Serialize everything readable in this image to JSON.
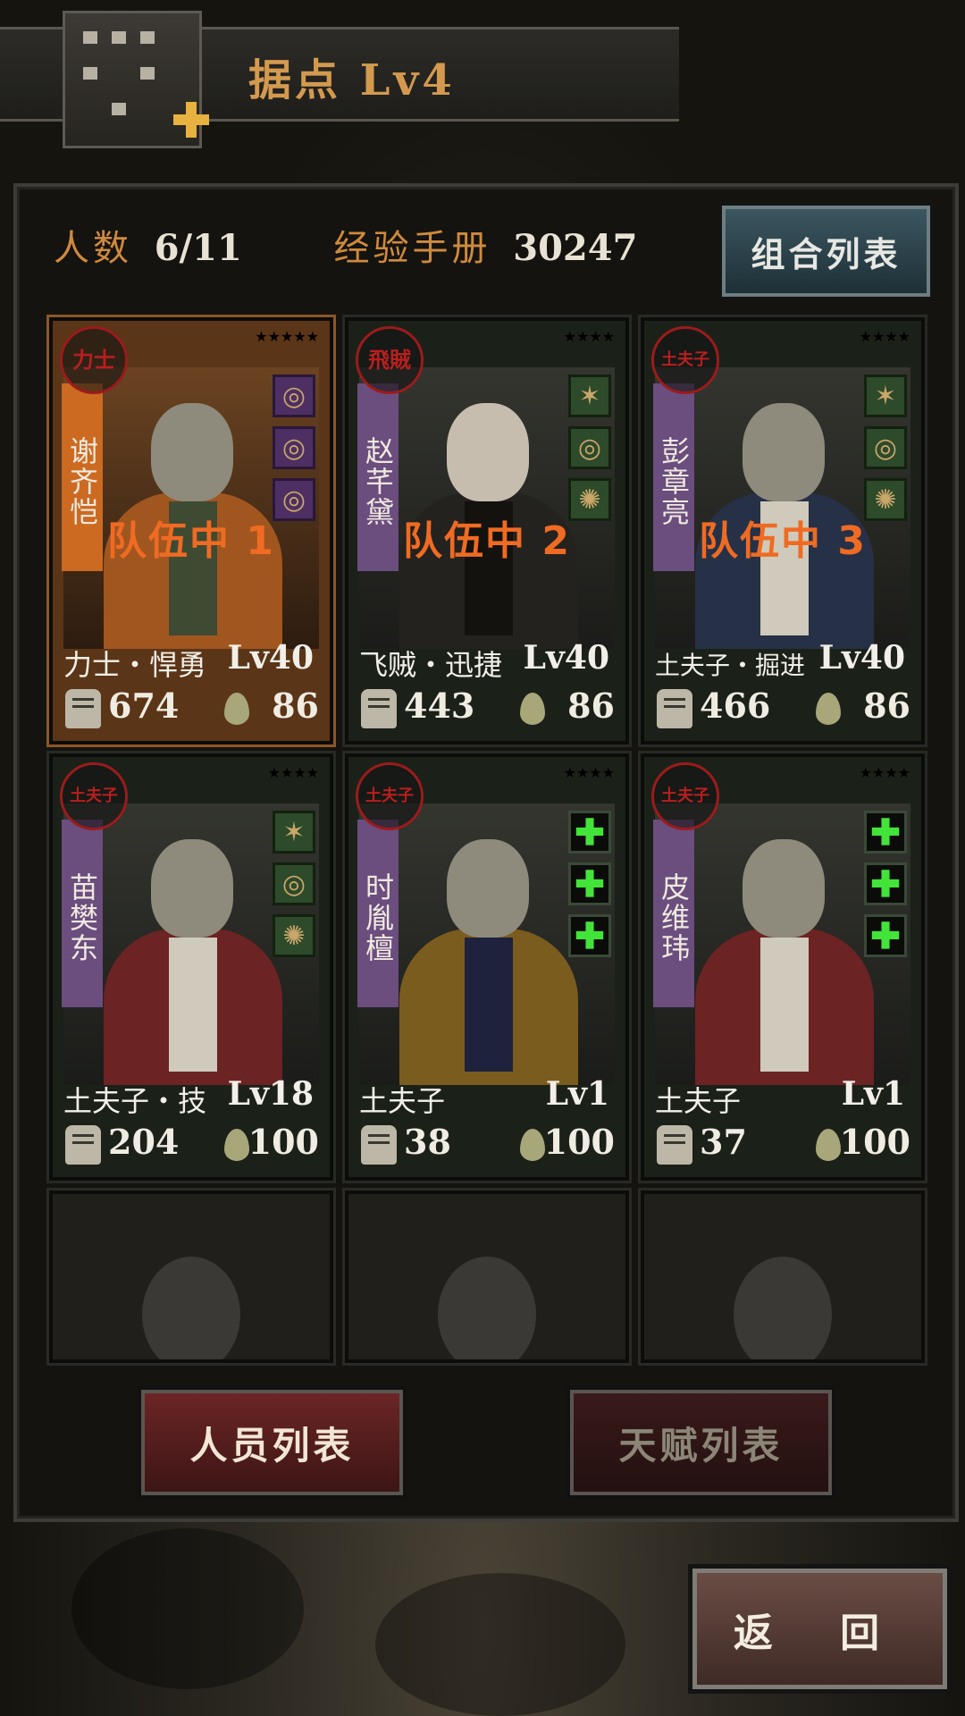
{
  "header": {
    "title": "据点 Lv4"
  },
  "stats": {
    "members_label": "人数",
    "members_value": "6/11",
    "exp_label": "经验手册",
    "exp_value": "30247"
  },
  "combo_button": "组合列表",
  "cards": [
    {
      "seal": "力士",
      "name": "谢齐恺",
      "stars": "★★★★★",
      "equip": [
        "◎",
        "◎",
        "◎"
      ],
      "team": "队伍中 1",
      "class": "力士・悍勇",
      "level": "Lv40",
      "power": "674",
      "spirit": "86"
    },
    {
      "seal": "飛賊",
      "name": "赵芊黛",
      "stars": "★★★★",
      "equip": [
        "✶",
        "◎",
        "✺"
      ],
      "team": "队伍中 2",
      "class": "飞贼・迅捷",
      "level": "Lv40",
      "power": "443",
      "spirit": "86"
    },
    {
      "seal": "土夫子",
      "name": "彭章亮",
      "stars": "★★★★",
      "equip": [
        "✶",
        "◎",
        "✺"
      ],
      "team": "队伍中 3",
      "class": "土夫子・掘进",
      "level": "Lv40",
      "power": "466",
      "spirit": "86"
    },
    {
      "seal": "土夫子",
      "name": "苗樊东",
      "stars": "★★★★",
      "equip": [
        "✶",
        "◎",
        "✺"
      ],
      "team": "",
      "class": "土夫子・技",
      "level": "Lv18",
      "power": "204",
      "spirit": "100"
    },
    {
      "seal": "土夫子",
      "name": "时胤檀",
      "stars": "★★★★",
      "equip": [
        "✚",
        "✚",
        "✚"
      ],
      "team": "",
      "class": "土夫子",
      "level": "Lv1",
      "power": "38",
      "spirit": "100"
    },
    {
      "seal": "土夫子",
      "name": "皮维玮",
      "stars": "★★★★",
      "equip": [
        "✚",
        "✚",
        "✚"
      ],
      "team": "",
      "class": "土夫子",
      "level": "Lv1",
      "power": "37",
      "spirit": "100"
    }
  ],
  "tabs": {
    "active": "人员列表",
    "inactive": "天赋列表"
  },
  "back_button": "返 回",
  "colors": {
    "accent": "#d39a4f",
    "team_label": "#ef6b23",
    "selected_card": "#5b3517"
  }
}
